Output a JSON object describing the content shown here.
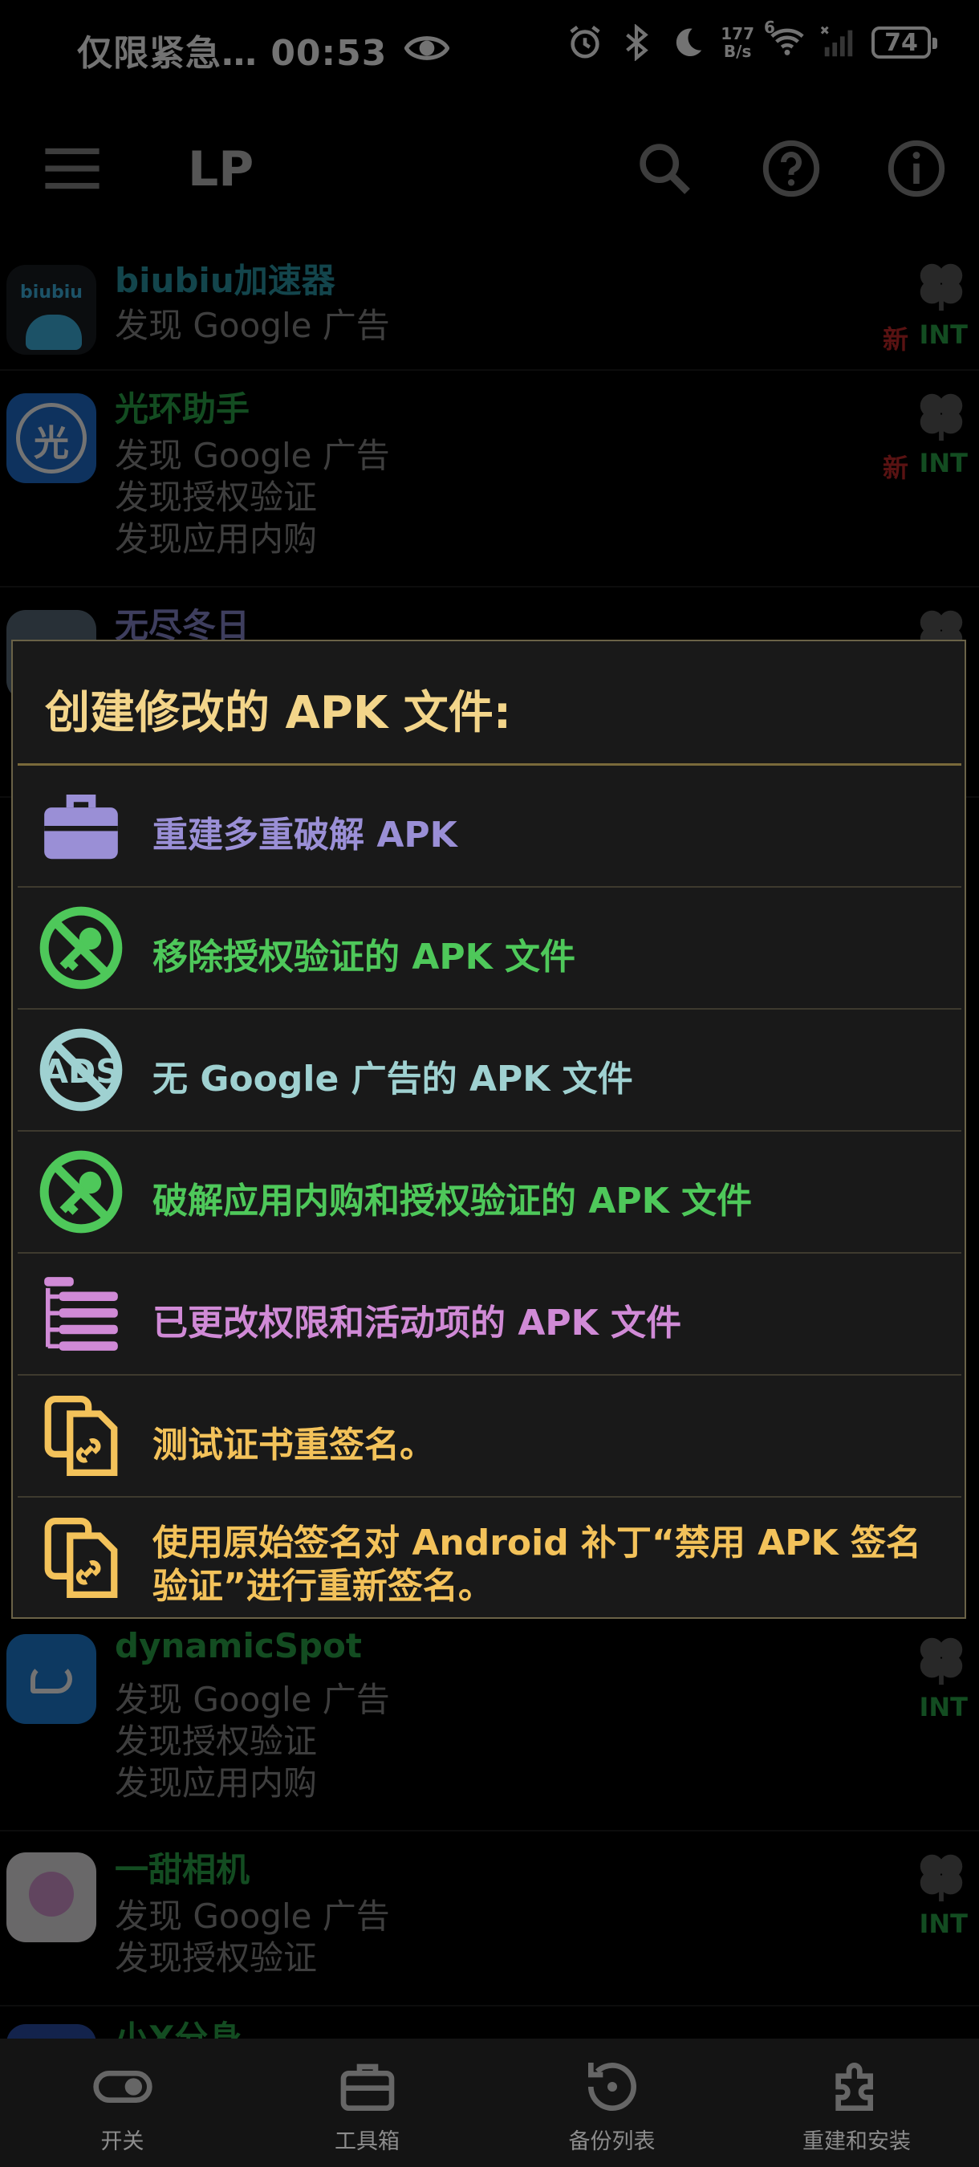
{
  "status_bar": {
    "notification_text": "仅限紧急… 00:53",
    "net_speed_value": "177",
    "net_speed_unit": "B/s",
    "wifi_badge": "6",
    "battery": "74"
  },
  "toolbar": {
    "title": "LP",
    "icons": [
      "menu-icon",
      "search-icon",
      "help-icon",
      "info-icon"
    ]
  },
  "apps": [
    {
      "name": "biubiu加速器",
      "icon_text": "biubiu",
      "lines": [
        "发现 Google 广告"
      ],
      "badge_new": "新",
      "badge_int": "INT"
    },
    {
      "name": "光环助手",
      "icon_text": "光",
      "lines": [
        "发现 Google 广告",
        "发现授权验证",
        "发现应用内购"
      ],
      "badge_new": "新",
      "badge_int": "INT"
    },
    {
      "name": "无尽冬日",
      "lines": []
    },
    {
      "name": "dynamicSpot",
      "lines": [
        "发现 Google 广告",
        "发现授权验证",
        "发现应用内购"
      ],
      "badge_int": "INT"
    },
    {
      "name": "一甜相机",
      "lines": [
        "发现 Google 广告",
        "发现授权验证"
      ],
      "badge_int": "INT"
    },
    {
      "name": "小X分身",
      "lines": []
    }
  ],
  "dialog": {
    "title": "创建修改的 APK 文件:",
    "options": [
      {
        "label": "重建多重破解 APK",
        "icon": "toolbox-icon",
        "color": "#9a8fd6"
      },
      {
        "label": "移除授权验证的 APK 文件",
        "icon": "no-license-key-icon",
        "color": "#4ec85a"
      },
      {
        "label": "无 Google 广告的 APK 文件",
        "icon": "no-ads-icon",
        "color": "#9fd1d1"
      },
      {
        "label": "破解应用内购和授权验证的 APK 文件",
        "icon": "no-purchase-key-icon",
        "color": "#4ec85a"
      },
      {
        "label": "已更改权限和活动项的 APK 文件",
        "icon": "permissions-list-icon",
        "color": "#d08ad6"
      },
      {
        "label": "测试证书重签名。",
        "icon": "resign-certificate-icon",
        "color": "#f3c25a"
      },
      {
        "label_line1": "使用原始签名对 Android 补丁“禁用 APK 签名",
        "label_line2": "验证”进行重新签名。",
        "icon": "resign-original-icon",
        "color": "#f3c25a"
      }
    ]
  },
  "bottom_nav": [
    {
      "label": "开关",
      "icon": "toggle-icon"
    },
    {
      "label": "工具箱",
      "icon": "toolbox-icon"
    },
    {
      "label": "备份列表",
      "icon": "backup-icon"
    },
    {
      "label": "重建和安装",
      "icon": "puzzle-icon"
    }
  ]
}
